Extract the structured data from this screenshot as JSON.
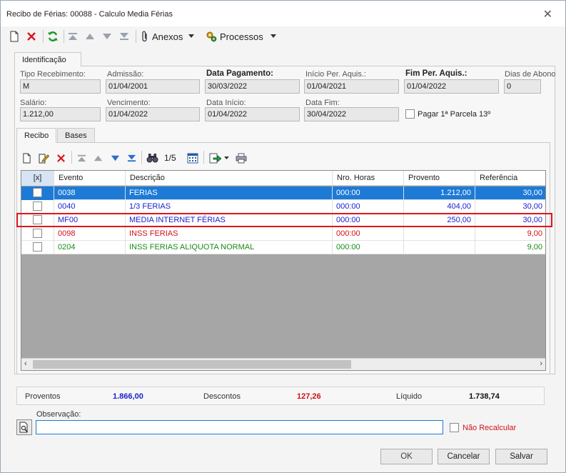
{
  "window": {
    "title": "Recibo de Férias: 00088 - Calculo Media Férias"
  },
  "toolbar": {
    "anexos_label": "Anexos",
    "processos_label": "Processos"
  },
  "tabs_top": [
    "Identificação"
  ],
  "fields": {
    "tipo_recebimento": {
      "label": "Tipo Recebimento:",
      "value": "M"
    },
    "admissao": {
      "label": "Admissão:",
      "value": "01/04/2001"
    },
    "data_pagamento": {
      "label": "Data Pagamento:",
      "value": "30/03/2022"
    },
    "inicio_per_aquis": {
      "label": "Início Per. Aquis.:",
      "value": "01/04/2021"
    },
    "fim_per_aquis": {
      "label": "Fim Per. Aquis.:",
      "value": "01/04/2022"
    },
    "dias_abono": {
      "label": "Dias de Abono",
      "value": "0"
    },
    "salario": {
      "label": "Salário:",
      "value": "1.212,00"
    },
    "vencimento": {
      "label": "Vencimento:",
      "value": "01/04/2022"
    },
    "data_inicio": {
      "label": "Data Início:",
      "value": "01/04/2022"
    },
    "data_fim": {
      "label": "Data Fim:",
      "value": "30/04/2022"
    },
    "pagar_parcela": {
      "label": "Pagar 1ª Parcela 13º"
    }
  },
  "tabs_inner": [
    "Recibo",
    "Bases"
  ],
  "grid_toolbar": {
    "page_indicator": "1/5"
  },
  "grid": {
    "columns": [
      "[x]",
      "Evento",
      "Descrição",
      "Nro. Horas",
      "Provento",
      "Referência"
    ],
    "rows": [
      {
        "evento": "0038",
        "descricao": "FERIAS",
        "horas": "000:00",
        "provento": "1.212,00",
        "referencia": "30,00",
        "color": "#ffffff",
        "selected": true
      },
      {
        "evento": "0040",
        "descricao": "1/3 FERIAS",
        "horas": "000:00",
        "provento": "404,00",
        "referencia": "30,00",
        "color": "#1a22cc",
        "selected": false
      },
      {
        "evento": "MF00",
        "descricao": "MEDIA INTERNET FÉRIAS",
        "horas": "000:00",
        "provento": "250,00",
        "referencia": "30,00",
        "color": "#1a22cc",
        "selected": false
      },
      {
        "evento": "0098",
        "descricao": "INSS FERIAS",
        "horas": "000:00",
        "provento": "",
        "referencia": "9,00",
        "color": "#d0101a",
        "selected": false
      },
      {
        "evento": "0204",
        "descricao": "INSS FERIAS ALIQUOTA NORMAL",
        "horas": "000:00",
        "provento": "",
        "referencia": "9,00",
        "color": "#1a8a1a",
        "selected": false
      }
    ]
  },
  "totals": {
    "proventos_label": "Proventos",
    "proventos_value": "1.866,00",
    "descontos_label": "Descontos",
    "descontos_value": "127,26",
    "liquido_label": "Líquido",
    "liquido_value": "1.738,74"
  },
  "observacao": {
    "label": "Observação:",
    "value": ""
  },
  "nao_recalcular": {
    "label": "Não Recalcular"
  },
  "buttons": {
    "ok": "OK",
    "cancelar": "Cancelar",
    "salvar": "Salvar"
  },
  "colors": {
    "selection": "#1d7ad6",
    "red": "#d0101a",
    "blue": "#1a22cc",
    "green": "#1a8a1a"
  }
}
